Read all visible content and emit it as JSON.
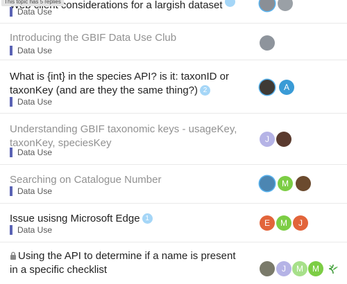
{
  "tooltip": "This topic has 5 replies",
  "topics": [
    {
      "title": "Web client considerations for a largish dataset",
      "category": "Data Use",
      "replies": "",
      "avatars": [
        {
          "name": "photo-1",
          "letter": "",
          "color": "#8a8f96"
        },
        {
          "name": "photo-2",
          "letter": "",
          "color": "#9aa0a6"
        }
      ]
    },
    {
      "title": "Introducing the GBIF Data Use Club",
      "category": "Data Use",
      "avatars": [
        {
          "name": "photo-1",
          "letter": "",
          "color": "#8e949c"
        }
      ]
    },
    {
      "title": "What is {int} in the species API? is it: taxonID or taxonKey (and are they the same thing?)",
      "category": "Data Use",
      "replies": "2",
      "avatars": [
        {
          "name": "photo-1",
          "letter": "",
          "color": "#3f3a35"
        },
        {
          "name": "avatar-a",
          "letter": "A",
          "color": "#3a9bd6"
        }
      ]
    },
    {
      "title": "Understanding GBIF taxonomic keys - usageKey, taxonKey, speciesKey",
      "category": "Data Use",
      "avatars": [
        {
          "name": "avatar-j",
          "letter": "J",
          "color": "#b5b3e6"
        },
        {
          "name": "photo-1",
          "letter": "",
          "color": "#5a3a2e"
        }
      ]
    },
    {
      "title": "Searching on Catalogue Number",
      "category": "Data Use",
      "avatars": [
        {
          "name": "photo-1",
          "letter": "",
          "color": "#4c86b2"
        },
        {
          "name": "avatar-m",
          "letter": "M",
          "color": "#7ccd44"
        },
        {
          "name": "photo-2",
          "letter": "",
          "color": "#6b4a2e"
        }
      ]
    },
    {
      "title": "Issue usisng Microsoft Edge",
      "category": "Data Use",
      "replies": "1",
      "avatars": [
        {
          "name": "avatar-e",
          "letter": "E",
          "color": "#e2643a"
        },
        {
          "name": "avatar-m",
          "letter": "M",
          "color": "#7ccd44"
        },
        {
          "name": "avatar-j",
          "letter": "J",
          "color": "#e2643a"
        }
      ]
    },
    {
      "title": "Using the API to determine if a name is present in a specific checklist",
      "category": "",
      "avatars": [
        {
          "name": "photo-1",
          "letter": "",
          "color": "#7a7a6a"
        },
        {
          "name": "avatar-j",
          "letter": "J",
          "color": "#b5b3e6"
        },
        {
          "name": "avatar-m",
          "letter": "M",
          "color": "#a7e08a"
        },
        {
          "name": "avatar-m-2",
          "letter": "M",
          "color": "#7ccd44"
        }
      ]
    }
  ]
}
